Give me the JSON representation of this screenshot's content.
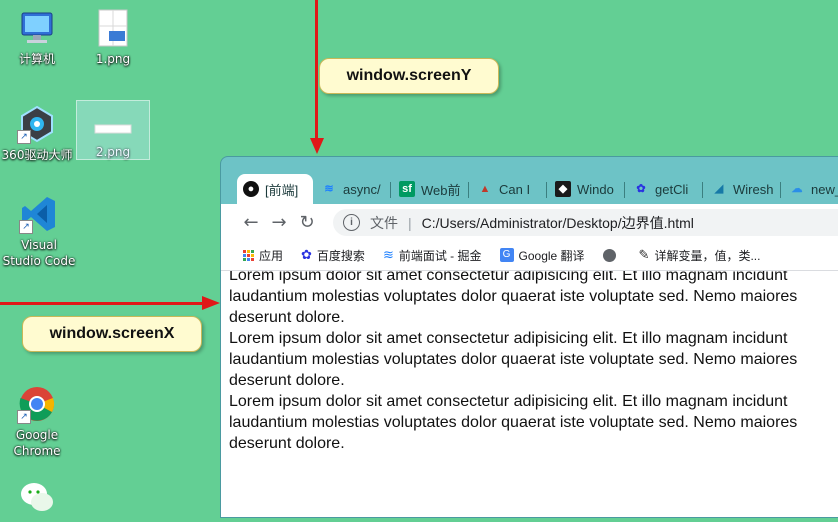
{
  "desktop": {
    "icons": [
      {
        "name": "计算机"
      },
      {
        "name": "1.png"
      },
      {
        "name": "360驱动大师"
      },
      {
        "name": "2.png"
      },
      {
        "name": "Visual Studio Code"
      },
      {
        "name": "Google Chrome"
      }
    ]
  },
  "annotations": {
    "screenY_label": "window.screenY",
    "screenX_label": "window.screenX",
    "arrow_color": "#e01818"
  },
  "browser": {
    "tabs": [
      {
        "title": "[前端]",
        "icon": "github-icon"
      },
      {
        "title": "async/",
        "icon": "juejin-icon"
      },
      {
        "title": "Web前",
        "icon": "segmentfault-icon"
      },
      {
        "title": "Can I",
        "icon": "caniuse-icon"
      },
      {
        "title": "Windo",
        "icon": "mdn-icon"
      },
      {
        "title": "getCli",
        "icon": "baidu-icon"
      },
      {
        "title": "Wiresh",
        "icon": "wireshark-icon"
      },
      {
        "title": "new_",
        "icon": "cloud-icon"
      }
    ],
    "omnibox": {
      "scheme_label": "文件",
      "url": "C:/Users/Administrator/Desktop/边界值.html"
    },
    "bookmarks": [
      {
        "label": "应用",
        "icon": "apps-grid-icon"
      },
      {
        "label": "百度搜索",
        "icon": "baidu-paw-icon"
      },
      {
        "label": "前端面试 - 掘金",
        "icon": "juejin-icon"
      },
      {
        "label": "Google 翻译",
        "icon": "google-translate-icon"
      },
      {
        "label": "",
        "icon": "globe-icon"
      },
      {
        "label": "详解变量，值，类...",
        "icon": "article-icon"
      }
    ],
    "content": {
      "paragraphs": [
        {
          "line1": "Lorem ipsum dolor sit amet consectetur adipisicing elit. Et illo magnam incidunt",
          "line2": "laudantium molestias voluptates dolor quaerat iste voluptate sed. Nemo maiores",
          "line3": "deserunt dolore."
        },
        {
          "line1": "Lorem ipsum dolor sit amet consectetur adipisicing elit. Et illo magnam incidunt",
          "line2": "laudantium molestias voluptates dolor quaerat iste voluptate sed. Nemo maiores",
          "line3": "deserunt dolore."
        },
        {
          "line1": "Lorem ipsum dolor sit amet consectetur adipisicing elit. Et illo magnam incidunt",
          "line2": "laudantium molestias voluptates dolor quaerat iste voluptate sed. Nemo maiores",
          "line3": "deserunt dolore."
        }
      ]
    }
  }
}
